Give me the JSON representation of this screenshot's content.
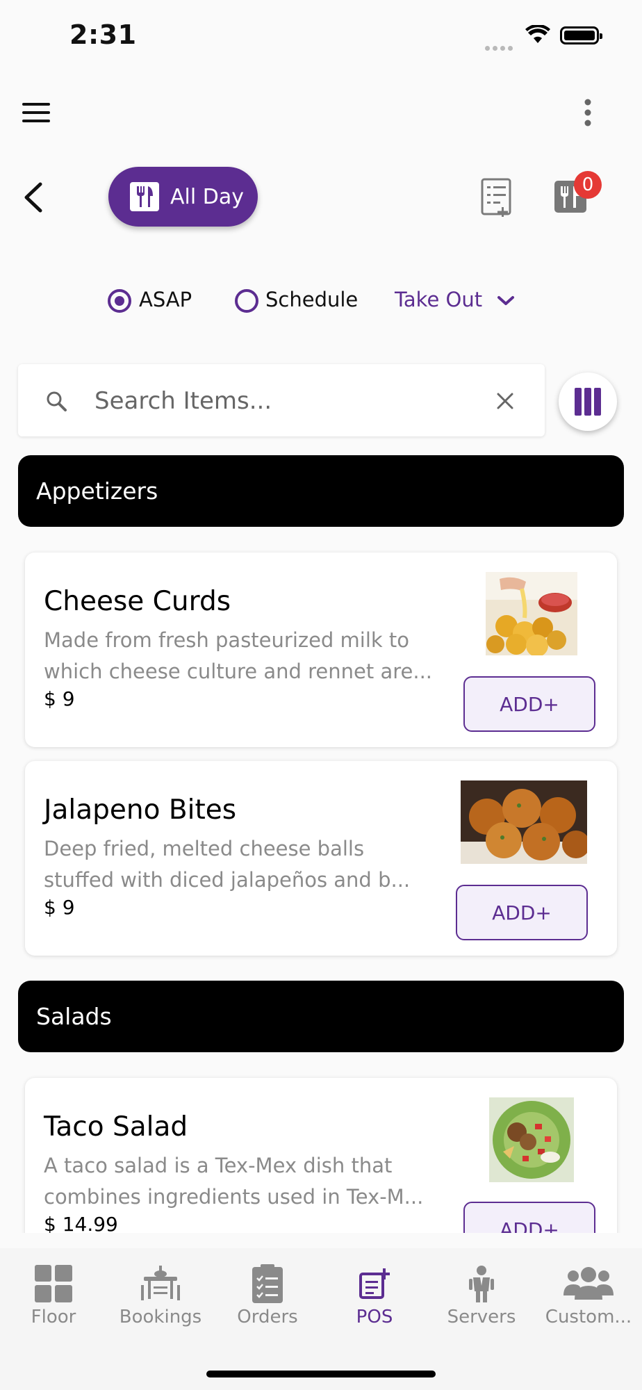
{
  "status_bar": {
    "time": "2:31"
  },
  "header": {
    "menu_mode_label": "All Day",
    "cart_count": "0"
  },
  "order_options": {
    "asap_label": "ASAP",
    "schedule_label": "Schedule",
    "order_type": "Take Out",
    "selected": "ASAP"
  },
  "search": {
    "placeholder": "Search Items..."
  },
  "sections": [
    {
      "title": "Appetizers",
      "items": [
        {
          "name": "Cheese Curds",
          "desc_line1": "Made from fresh pasteurized milk to",
          "desc_line2": "which cheese culture and rennet are...",
          "price": "$ 9",
          "add_label": "ADD+"
        },
        {
          "name": "Jalapeno Bites",
          "desc_line1": "Deep fried, melted cheese balls",
          "desc_line2": "stuffed with diced jalapeños and b...",
          "price": "$ 9",
          "add_label": "ADD+"
        }
      ]
    },
    {
      "title": "Salads",
      "items": [
        {
          "name": "Taco Salad",
          "desc_line1": "A taco salad is a Tex-Mex dish that",
          "desc_line2": "combines ingredients used in Tex-M...",
          "price": "$ 14.99",
          "add_label": "ADD+"
        }
      ]
    }
  ],
  "tabs": [
    {
      "label": "Floor",
      "icon": "floor-icon"
    },
    {
      "label": "Bookings",
      "icon": "bookings-icon"
    },
    {
      "label": "Orders",
      "icon": "orders-icon"
    },
    {
      "label": "POS",
      "icon": "pos-icon",
      "active": true
    },
    {
      "label": "Servers",
      "icon": "servers-icon"
    },
    {
      "label": "Custom...",
      "icon": "customers-icon"
    }
  ],
  "colors": {
    "accent": "#5c2d91",
    "badge": "#e53935",
    "section_bar": "#000000"
  }
}
